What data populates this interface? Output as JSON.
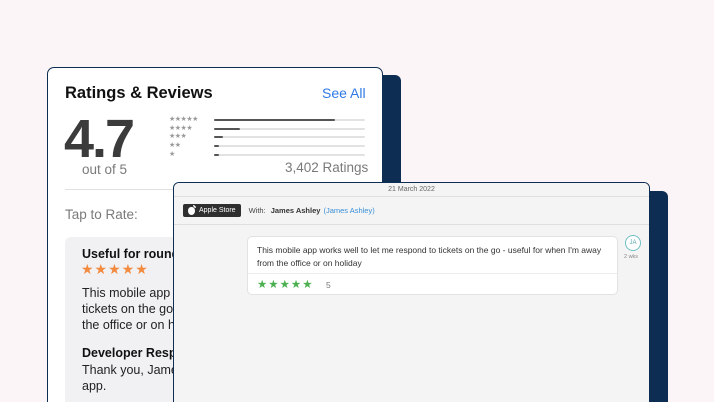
{
  "ratings": {
    "title": "Ratings & Reviews",
    "see_all": "See All",
    "score": "4.7",
    "out_of": "out of 5",
    "count": "3,402 Ratings",
    "tap_to_rate": "Tap to Rate:",
    "distribution": [
      {
        "stars": "★★★★★",
        "fraction": 0.8
      },
      {
        "stars": "★★★★",
        "fraction": 0.17
      },
      {
        "stars": "★★★",
        "fraction": 0.06
      },
      {
        "stars": "★★",
        "fraction": 0.03
      },
      {
        "stars": "★",
        "fraction": 0.03
      }
    ],
    "review": {
      "title": "Useful for round the world",
      "stars": "★★★★★",
      "body": "This mobile app works well to let me respond to tickets on the go - useful for when I'm away from the office or on holiday",
      "developer_title": "Developer Response",
      "developer_body": "Thank you, James! We're glad you're enjoying the app."
    }
  },
  "conversation": {
    "date": "21 March 2022",
    "store_badge": "Apple Store",
    "store_icon": "apple-icon",
    "with_label": "With:",
    "with_name": "James Ashley",
    "with_handle": "(James Ashley)",
    "message": {
      "text": "This mobile app works well to let me respond to tickets on the go - useful for when I'm away from the office or on holiday",
      "stars": "★★★★★",
      "score": "5"
    },
    "avatar_initials": "JA",
    "time_ago": "2 wks"
  },
  "colors": {
    "accent_link": "#2f7ae5",
    "navy": "#0d2d52",
    "review_star": "#f28a3f",
    "message_star": "#4caf50"
  }
}
